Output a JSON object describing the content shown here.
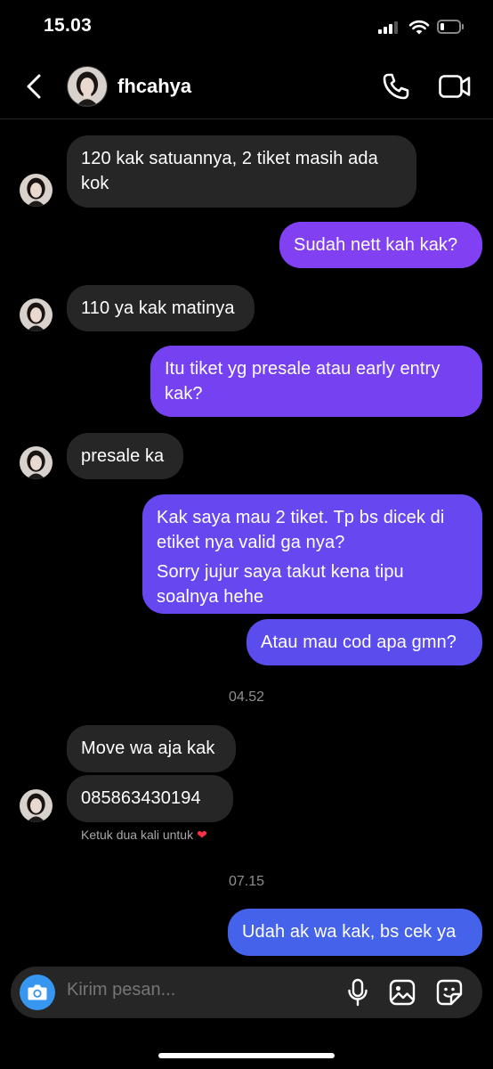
{
  "status_bar": {
    "time": "15.03",
    "battery_level": 0.2
  },
  "header": {
    "contact_name": "fhcahya",
    "icons": {
      "back": "chevron-left-icon",
      "call": "phone-icon",
      "video": "video-camera-icon"
    }
  },
  "messages": [
    {
      "direction": "in",
      "lines": [
        "120 kak satuannya, 2 tiket masih ada kok"
      ]
    },
    {
      "direction": "out",
      "lines": [
        "Sudah nett kah kak?"
      ]
    },
    {
      "direction": "in",
      "lines": [
        "110 ya kak matinya"
      ]
    },
    {
      "direction": "out",
      "lines": [
        "Itu tiket yg presale atau early entry kak?"
      ]
    },
    {
      "direction": "in",
      "lines": [
        "presale ka"
      ]
    },
    {
      "direction": "out",
      "lines": [
        "Kak saya mau 2 tiket. Tp bs dicek di etiket nya valid ga nya?",
        "Sorry jujur saya takut kena tipu soalnya hehe"
      ]
    },
    {
      "direction": "out",
      "lines": [
        "Atau mau cod apa gmn?"
      ]
    },
    {
      "direction": "in",
      "lines": [
        "Move wa aja kak"
      ]
    },
    {
      "direction": "in",
      "lines": [
        "085863430194"
      ]
    },
    {
      "direction": "out",
      "lines": [
        "Udah ak wa kak, bs cek ya"
      ]
    }
  ],
  "timestamps": [
    "04.52",
    "07.15"
  ],
  "double_tap_hint": "Ketuk dua kali untuk",
  "double_tap_hint_icon": "heart-icon",
  "composer": {
    "placeholder": "Kirim pesan...",
    "icons": {
      "camera": "camera-icon",
      "mic": "microphone-icon",
      "gallery": "image-icon",
      "sticker": "sticker-icon"
    }
  },
  "colors": {
    "background": "#000000",
    "incoming_bubble": "#262626",
    "outgoing_gradient": [
      "#8a3ff0",
      "#5b56f0",
      "#3d60e8"
    ],
    "camera_button": "#3797f0",
    "heart": "#ff3040"
  }
}
